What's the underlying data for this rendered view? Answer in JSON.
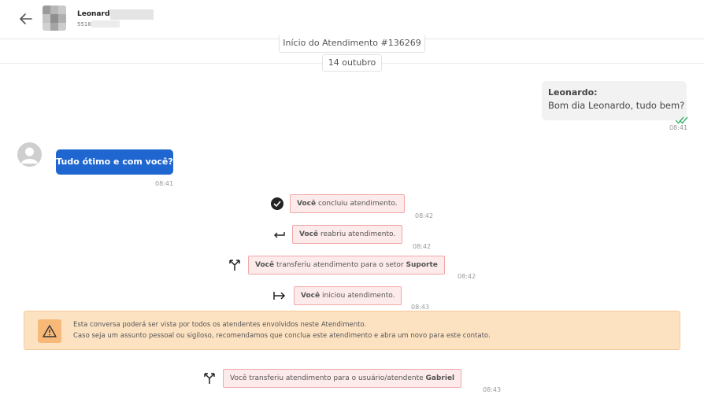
{
  "header": {
    "contact_name": "Leonardo",
    "contact_phone": "5518"
  },
  "chat": {
    "start_label": "Início do Atendimento #136269",
    "date_label": "14 outubro",
    "outgoing": {
      "sender": "Leonardo:",
      "text": "Bom dia Leonardo, tudo bem?",
      "time": "08:41"
    },
    "incoming": {
      "text": "Tudo ótimo e com você?",
      "time": "08:41"
    },
    "events": [
      {
        "icon": "check-circle-icon",
        "prefix": "Você",
        "text": " concluiu atendimento.",
        "suffix": "",
        "time": "08:42"
      },
      {
        "icon": "return-arrow-icon",
        "prefix": "Você",
        "text": " reabriu atendimento.",
        "suffix": "",
        "time": "08:42"
      },
      {
        "icon": "transfer-icon",
        "prefix": "Você",
        "text": " transferiu atendimento para o setor ",
        "suffix": "Suporte",
        "time": "08:42"
      },
      {
        "icon": "start-arrow-icon",
        "prefix": "Você",
        "text": " iniciou atendimento.",
        "suffix": "",
        "time": "08:43"
      },
      {
        "icon": "transfer-icon",
        "prefix": "",
        "text": "Você transferiu atendimento para o usuário/atendente ",
        "suffix": "Gabriel",
        "time": "08:43"
      }
    ],
    "warning": {
      "line1": "Esta conversa poderá ser vista por todos os atendentes envolvidos neste Atendimento.",
      "line2": "Caso seja um assunto pessoal ou sigiloso, recomendamos que conclua este atendimento e abra um novo para este contato."
    }
  }
}
